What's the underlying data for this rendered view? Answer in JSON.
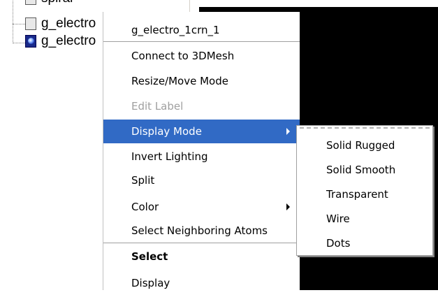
{
  "tree": {
    "items": [
      {
        "label": "spiral",
        "icon": "box-node-icon"
      },
      {
        "label": "g_electro",
        "icon": "box-node-icon"
      },
      {
        "label": "g_electro",
        "icon": "sphere-node-icon"
      }
    ]
  },
  "context_menu": {
    "header": "g_electro_1crn_1",
    "items": [
      {
        "label": "Connect to 3DMesh"
      },
      {
        "label": "Resize/Move Mode"
      },
      {
        "label": "Edit Label",
        "state": "disabled"
      },
      {
        "label": "Display Mode",
        "state": "selected",
        "has_submenu": true
      },
      {
        "label": "Invert Lighting"
      },
      {
        "label": "Split"
      },
      {
        "label": "Color",
        "has_submenu": true
      },
      {
        "label": "Select Neighboring Atoms"
      },
      {
        "label": "Select",
        "style": "bold"
      },
      {
        "label": "Display"
      }
    ]
  },
  "submenu": {
    "items": [
      {
        "label": "Solid Rugged"
      },
      {
        "label": "Solid Smooth"
      },
      {
        "label": "Transparent"
      },
      {
        "label": "Wire"
      },
      {
        "label": "Dots"
      }
    ]
  },
  "colors": {
    "selection": "#316ac5",
    "viewport_background": "#000000",
    "disabled_text": "#a0a0a0"
  }
}
